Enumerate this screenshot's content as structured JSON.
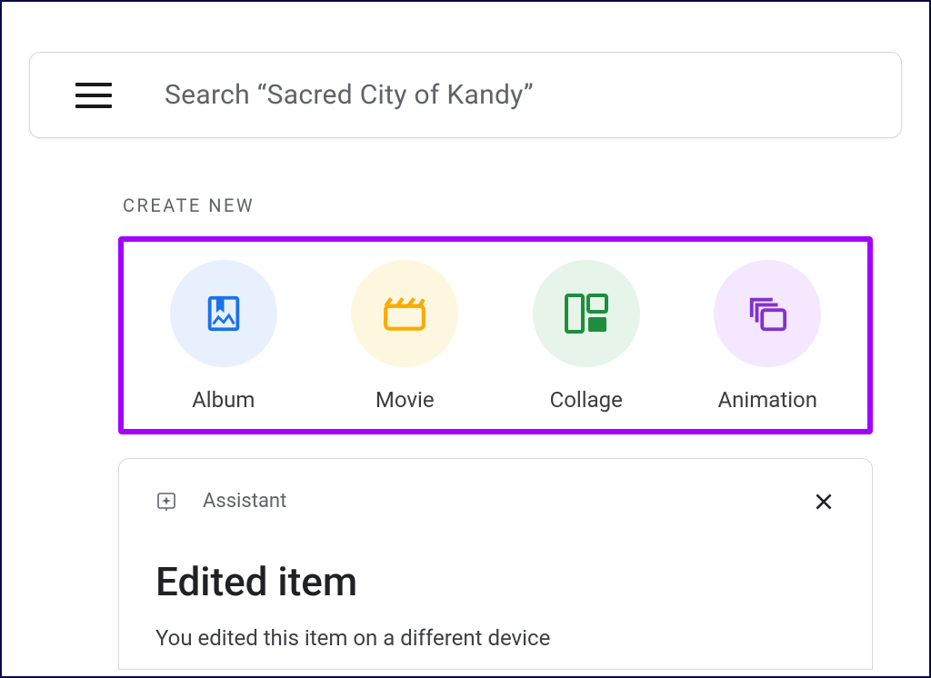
{
  "search": {
    "placeholder": "Search “Sacred City of Kandy”"
  },
  "create": {
    "header": "CREATE NEW",
    "items": [
      {
        "label": "Album"
      },
      {
        "label": "Movie"
      },
      {
        "label": "Collage"
      },
      {
        "label": "Animation"
      }
    ]
  },
  "assistant": {
    "label": "Assistant",
    "card_title": "Edited item",
    "card_desc": "You edited this item on a different device"
  }
}
